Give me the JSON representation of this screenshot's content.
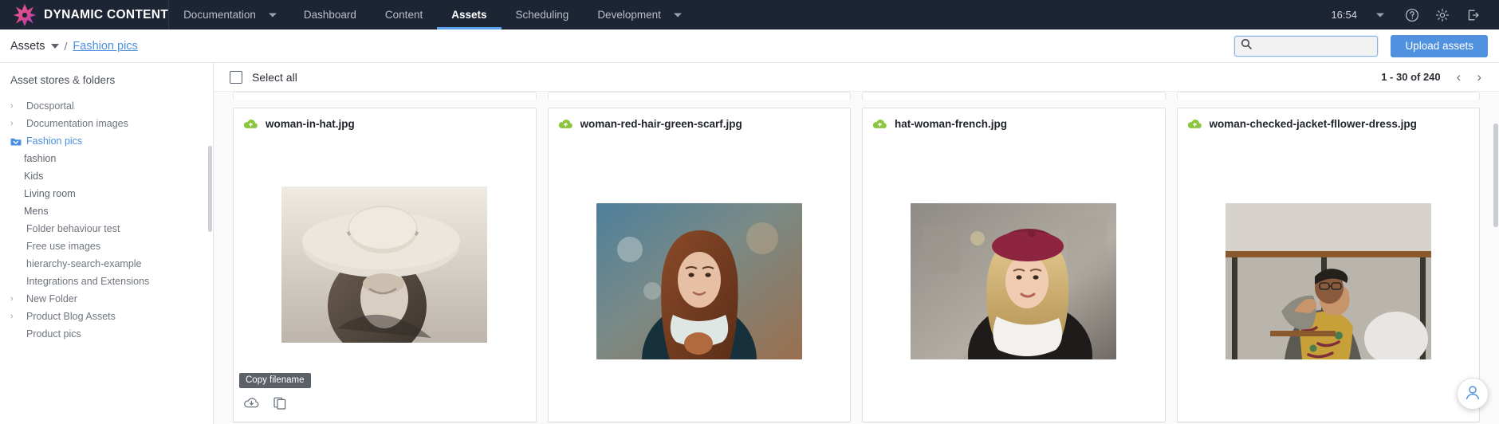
{
  "topnav": {
    "brand": "DYNAMIC CONTENT",
    "logo_icon": "starburst-logo-icon",
    "items": [
      {
        "label": "Documentation",
        "caret": true,
        "active": false
      },
      {
        "label": "Dashboard",
        "caret": false,
        "active": false
      },
      {
        "label": "Content",
        "caret": false,
        "active": false
      },
      {
        "label": "Assets",
        "caret": false,
        "active": true
      },
      {
        "label": "Scheduling",
        "caret": false,
        "active": false
      },
      {
        "label": "Development",
        "caret": true,
        "active": false
      }
    ],
    "clock": "16:54",
    "icons": {
      "account_caret": "chevron-down-icon",
      "help": "help-circle-icon",
      "settings": "gear-icon",
      "logout": "logout-icon"
    },
    "active_underline_color": "#5ea2f0",
    "background_color": "#1d2433"
  },
  "subbar": {
    "breadcrumb_root": "Assets",
    "breadcrumb_separator": "/",
    "breadcrumb_current": "Fashion pics",
    "search": {
      "value": "",
      "placeholder": "",
      "icon": "search-icon"
    },
    "upload_button": "Upload assets",
    "accent_color": "#5092e0"
  },
  "sidebar": {
    "title": "Asset stores & folders",
    "items": [
      {
        "label": "Docsportal",
        "chevron": true,
        "indent": 0,
        "selected": false,
        "folder": false
      },
      {
        "label": "Documentation images",
        "chevron": true,
        "indent": 0,
        "selected": false,
        "folder": false
      },
      {
        "label": "Fashion pics",
        "chevron": false,
        "indent": 0,
        "selected": true,
        "folder": true
      },
      {
        "label": "fashion",
        "chevron": false,
        "indent": 1,
        "selected": false,
        "folder": false
      },
      {
        "label": "Kids",
        "chevron": false,
        "indent": 1,
        "selected": false,
        "folder": false
      },
      {
        "label": "Living room",
        "chevron": false,
        "indent": 1,
        "selected": false,
        "folder": false
      },
      {
        "label": "Mens",
        "chevron": false,
        "indent": 1,
        "selected": false,
        "folder": false
      },
      {
        "label": "Folder behaviour test",
        "chevron": false,
        "indent": 0,
        "selected": false,
        "folder": false
      },
      {
        "label": "Free use images",
        "chevron": false,
        "indent": 0,
        "selected": false,
        "folder": false
      },
      {
        "label": "hierarchy-search-example",
        "chevron": false,
        "indent": 0,
        "selected": false,
        "folder": false
      },
      {
        "label": "Integrations and Extensions",
        "chevron": false,
        "indent": 0,
        "selected": false,
        "folder": false
      },
      {
        "label": "New Folder",
        "chevron": true,
        "indent": 0,
        "selected": false,
        "folder": false
      },
      {
        "label": "Product Blog Assets",
        "chevron": true,
        "indent": 0,
        "selected": false,
        "folder": false
      },
      {
        "label": "Product pics",
        "chevron": false,
        "indent": 0,
        "selected": false,
        "folder": false
      }
    ]
  },
  "content": {
    "select_all_label": "Select all",
    "select_all_checked": false,
    "pagination": {
      "range_text": "1 - 30 of 240",
      "prev_icon": "chevron-left-icon",
      "next_icon": "chevron-right-icon"
    },
    "cards": [
      {
        "filename": "woman-in-hat.jpg",
        "status_icon": "cloud-upload-icon",
        "status_color": "#8cc63f",
        "thumb_alt": "black-and-white photo of woman wearing wide-brim sun hat"
      },
      {
        "filename": "woman-red-hair-green-scarf.jpg",
        "status_icon": "cloud-upload-icon",
        "status_color": "#8cc63f",
        "thumb_alt": "woman with red hair and green scarf on blurred street"
      },
      {
        "filename": "hat-woman-french.jpg",
        "status_icon": "cloud-upload-icon",
        "status_color": "#8cc63f",
        "thumb_alt": "blonde woman in burgundy beret and white scarf"
      },
      {
        "filename": "woman-checked-jacket-fllower-dress.jpg",
        "status_icon": "cloud-upload-icon",
        "status_color": "#8cc63f",
        "thumb_alt": "woman in checked jacket and floral dress seated at table"
      }
    ],
    "tooltip": "Copy filename",
    "card_actions": {
      "download_icon": "cloud-download-icon",
      "copy_icon": "copy-filename-icon"
    },
    "fab_icon": "assistant-icon"
  }
}
